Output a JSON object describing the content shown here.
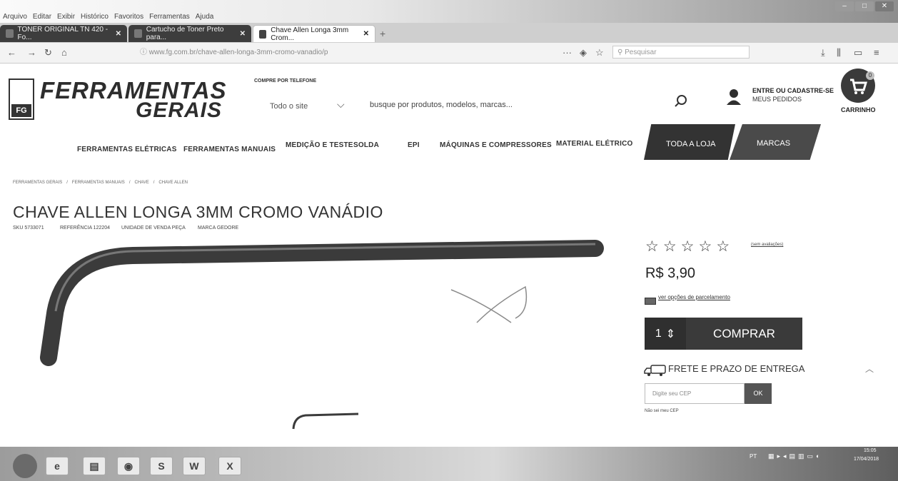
{
  "browser": {
    "menu": [
      "Arquivo",
      "Editar",
      "Exibir",
      "Histórico",
      "Favoritos",
      "Ferramentas",
      "Ajuda"
    ],
    "tabs": [
      {
        "label": "TONER ORIGINAL TN 420 - Fo..."
      },
      {
        "label": "Cartucho de Toner Preto para..."
      },
      {
        "label": "Chave Allen Longa 3mm Crom..."
      }
    ],
    "url": "www.fg.com.br/chave-allen-longa-3mm-cromo-vanadio/p",
    "search_placeholder": "Pesquisar"
  },
  "site": {
    "logo_line1": "FERRAMENTAS",
    "logo_line2": "GERAIS",
    "logo_badge": "FG",
    "compre_label": "COMPRE POR TELEFONE",
    "scope": "Todo o site",
    "search_placeholder": "busque por produtos, modelos, marcas...",
    "account_line1": "ENTRE OU CADASTRE-SE",
    "account_line2": "MEUS PEDIDOS",
    "cart_label": "CARRINHO",
    "cart_count": "0"
  },
  "categories": [
    "FERRAMENTAS ELÉTRICAS",
    "FERRAMENTAS MANUAIS",
    "MEDIÇÃO E TESTE",
    "SOLDA",
    "EPI",
    "MÁQUINAS E COMPRESSORES",
    "MATERIAL ELÉTRICO"
  ],
  "nav_special": {
    "toda": "TODA A LOJA",
    "marcas": "MARCAS"
  },
  "breadcrumb": [
    "FERRAMENTAS GERAIS",
    "/",
    "FERRAMENTAS MANUAIS",
    "/",
    "CHAVE",
    "/",
    "CHAVE ALLEN"
  ],
  "product": {
    "title": "CHAVE ALLEN LONGA 3MM CROMO VANÁDIO",
    "sku": "SKU 5733071",
    "reference": "REFERÊNCIA 122204",
    "unit": "UNIDADE DE VENDA PEÇA",
    "brand": "MARCA GEDORE",
    "rating_stars": 0,
    "avaliacoes": "(sem avaliações)",
    "price": "R$ 3,90",
    "parcelamento": "ver opções de parcelamento",
    "quantity": "1",
    "qty_arrows": "⇕",
    "buy_label": "COMPRAR",
    "frete_title": "FRETE E PRAZO DE ENTREGA",
    "cep_placeholder": "Digite seu CEP",
    "ok_label": "OK",
    "nao_sei_cep": "Não sei meu CEP"
  },
  "taskbar": {
    "apps": [
      "ie",
      "folder",
      "chrome",
      "skype",
      "W",
      "X"
    ],
    "tray": "PT",
    "time": "15:05",
    "date": "17/04/2018"
  }
}
